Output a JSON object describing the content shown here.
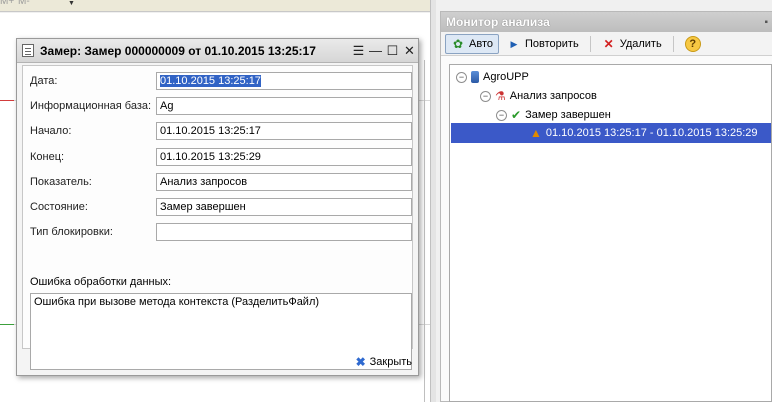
{
  "background": {
    "toolbar_glyphs": [
      "M+",
      "M-",
      "▼"
    ]
  },
  "monitor": {
    "title": "Монитор анализа",
    "toolbar": {
      "auto_label": "Авто",
      "repeat_label": "Повторить",
      "delete_label": "Удалить",
      "help_label": "?"
    },
    "tree": [
      {
        "label": "AgroUPP",
        "level": 0,
        "icon": "database-icon",
        "expanded": true
      },
      {
        "label": "Анализ запросов",
        "level": 1,
        "icon": "query-analysis-icon",
        "expanded": true
      },
      {
        "label": "Замер завершен",
        "level": 2,
        "icon": "measurement-done-icon",
        "expanded": true
      },
      {
        "label": "01.10.2015 13:25:17 - 01.10.2015 13:25:29",
        "level": 3,
        "icon": "measurement-icon",
        "selected": true
      }
    ]
  },
  "dialog": {
    "title": "Замер: Замер 000000009 от 01.10.2015 13:25:17",
    "fields": {
      "date": {
        "label": "Дата:",
        "value": "01.10.2015 13:25:17"
      },
      "infobase": {
        "label": "Информационная база:",
        "value": "Ag"
      },
      "start": {
        "label": "Начало:",
        "value": "01.10.2015 13:25:17"
      },
      "end": {
        "label": "Конец:",
        "value": "01.10.2015 13:25:29"
      },
      "metric": {
        "label": "Показатель:",
        "value": "Анализ запросов"
      },
      "state": {
        "label": "Состояние:",
        "value": "Замер завершен"
      },
      "lock": {
        "label": "Тип блокировки:",
        "value": ""
      }
    },
    "error_label": "Ошибка обработки данных:",
    "error_text": "Ошибка при вызове метода контекста (РазделитьФайл)",
    "close_label": "Закрыть"
  },
  "colors": {
    "selection": "#3b59c8",
    "field_highlight": "#3163c5",
    "chart_red": "#d23c3c",
    "chart_green": "#3ca03c"
  }
}
